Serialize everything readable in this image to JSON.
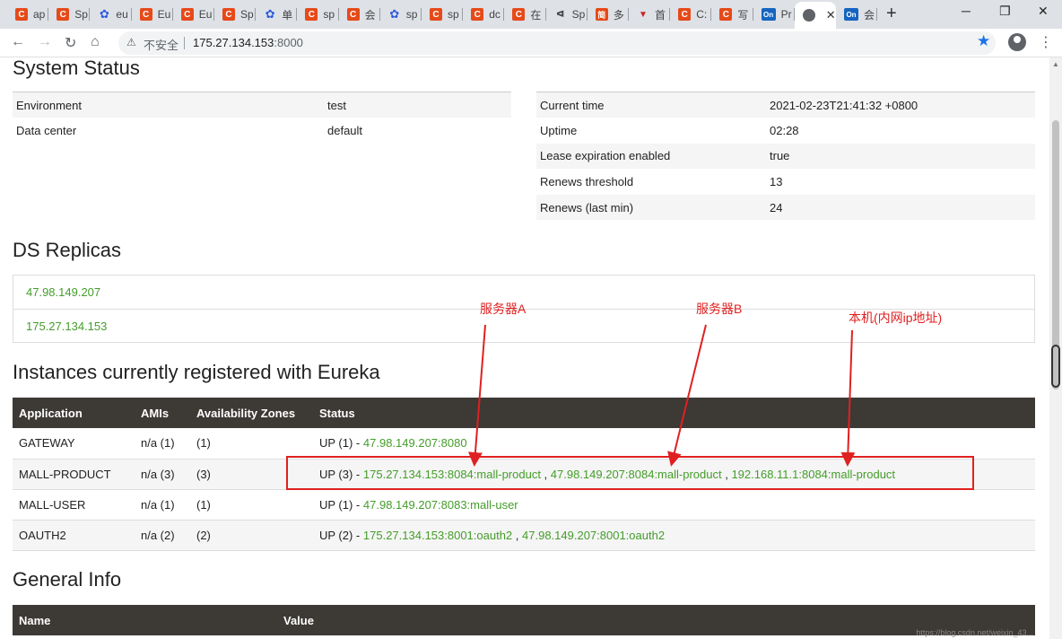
{
  "browser": {
    "tabs": [
      {
        "icon": "C",
        "color": "#e64a19",
        "label": "ap"
      },
      {
        "icon": "C",
        "color": "#e64a19",
        "label": "Sp"
      },
      {
        "icon": "paw",
        "color": "#2e5be0",
        "label": "eu"
      },
      {
        "icon": "C",
        "color": "#e64a19",
        "label": "Eu"
      },
      {
        "icon": "C",
        "color": "#e64a19",
        "label": "Eu"
      },
      {
        "icon": "C",
        "color": "#e64a19",
        "label": "Sp"
      },
      {
        "icon": "paw",
        "color": "#2e5be0",
        "label": "单"
      },
      {
        "icon": "C",
        "color": "#e64a19",
        "label": "sp"
      },
      {
        "icon": "C",
        "color": "#e64a19",
        "label": "会"
      },
      {
        "icon": "paw",
        "color": "#2e5be0",
        "label": "sp"
      },
      {
        "icon": "C",
        "color": "#e64a19",
        "label": "sp"
      },
      {
        "icon": "C",
        "color": "#e64a19",
        "label": "dc"
      },
      {
        "icon": "C",
        "color": "#e64a19",
        "label": "在"
      },
      {
        "icon": "dog",
        "color": "#444444",
        "label": "Sp"
      },
      {
        "icon": "jian",
        "color": "#e64a19",
        "label": "多"
      },
      {
        "icon": "cart",
        "color": "#cc2222",
        "label": "首"
      },
      {
        "icon": "C",
        "color": "#e64a19",
        "label": "C:"
      },
      {
        "icon": "C",
        "color": "#e64a19",
        "label": "写"
      },
      {
        "icon": "On",
        "color": "#1565c0",
        "label": "Pr"
      },
      {
        "icon": "globe",
        "color": "#5f6368",
        "label": ""
      },
      {
        "icon": "On",
        "color": "#1565c0",
        "label": "会"
      }
    ],
    "new_tab": "+",
    "window_controls": {
      "minimize": "─",
      "maximize": "❐",
      "close": "✕"
    },
    "security_label": "不安全",
    "url_host": "175.27.134.153",
    "url_port": ":8000"
  },
  "system_status": {
    "title": "System Status",
    "left": [
      {
        "key": "Environment",
        "value": "test"
      },
      {
        "key": "Data center",
        "value": "default"
      }
    ],
    "right": [
      {
        "key": "Current time",
        "value": "2021-02-23T21:41:32 +0800"
      },
      {
        "key": "Uptime",
        "value": "02:28"
      },
      {
        "key": "Lease expiration enabled",
        "value": "true"
      },
      {
        "key": "Renews threshold",
        "value": "13"
      },
      {
        "key": "Renews (last min)",
        "value": "24"
      }
    ]
  },
  "ds_replicas": {
    "title": "DS Replicas",
    "items": [
      "47.98.149.207",
      "175.27.134.153"
    ]
  },
  "instances": {
    "title": "Instances currently registered with Eureka",
    "headers": [
      "Application",
      "AMIs",
      "Availability Zones",
      "Status"
    ],
    "rows": [
      {
        "app": "GATEWAY",
        "amis": "n/a (1)",
        "zones": "(1)",
        "status": "UP (1) - ",
        "links": [
          "47.98.149.207:8080"
        ]
      },
      {
        "app": "MALL-PRODUCT",
        "amis": "n/a (3)",
        "zones": "(3)",
        "status": "UP (3) - ",
        "links": [
          "175.27.134.153:8084:mall-product",
          "47.98.149.207:8084:mall-product",
          "192.168.11.1:8084:mall-product"
        ]
      },
      {
        "app": "MALL-USER",
        "amis": "n/a (1)",
        "zones": "(1)",
        "status": "UP (1) - ",
        "links": [
          "47.98.149.207:8083:mall-user"
        ]
      },
      {
        "app": "OAUTH2",
        "amis": "n/a (2)",
        "zones": "(2)",
        "status": "UP (2) - ",
        "links": [
          "175.27.134.153:8001:oauth2",
          "47.98.149.207:8001:oauth2"
        ]
      }
    ]
  },
  "general_info": {
    "title": "General Info",
    "headers": [
      "Name",
      "Value"
    ]
  },
  "annotations": {
    "label_a": "服务器A",
    "label_b": "服务器B",
    "label_local": "本机(内网ip地址)",
    "color": "#e02020"
  },
  "watermark": "https://blog.csdn.net/weixin_43..."
}
